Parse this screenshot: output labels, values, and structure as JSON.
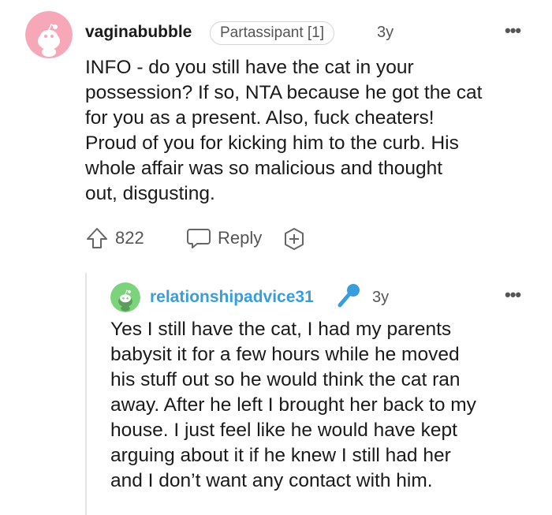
{
  "comments": [
    {
      "username": "vaginabubble",
      "flair": "Partassipant [1]",
      "time": "3y",
      "body_lines": [
        "INFO - do you still have the cat in your",
        "possession? If so, NTA because he got the cat",
        "for you as a present. Also, fuck cheaters!",
        "Proud of you for kicking him to the curb. His",
        "whole affair was so malicious and thought",
        "out, disgusting."
      ],
      "score": "822",
      "reply_label": "Reply",
      "avatar_color": "#f7a8b8"
    },
    {
      "username": "relationshipadvice31",
      "time": "3y",
      "body_lines": [
        "Yes I still have the cat, I had my parents",
        "babysit it for a few hours while he moved",
        "his stuff out so he would think the cat ran",
        "away. After he left I brought her back to my",
        "house. I just feel like he would have kept",
        "arguing about it if he knew I still had her",
        "and I don’t want any contact with him."
      ],
      "username_color": "#3a9ddb",
      "avatar_color": "#7bd47b"
    }
  ],
  "icons": {
    "more": "more-options-icon",
    "upvote": "upvote-arrow-icon",
    "reply": "reply-bubble-icon",
    "award": "add-award-icon",
    "op_badge": "microphone-icon"
  }
}
